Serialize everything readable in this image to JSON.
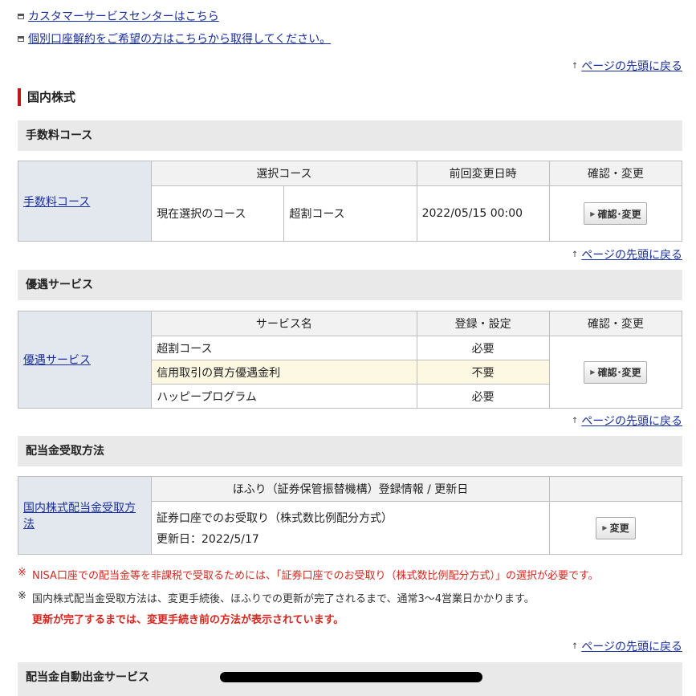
{
  "links": {
    "customer_center": "カスタマーサービスセンターはこちら",
    "account_cancel": "個別口座解約をご希望の方はこちらから取得してください。",
    "back_to_top": "ページの先頭に戻る"
  },
  "section": {
    "title": "国内株式"
  },
  "fee_course": {
    "subhead": "手数料コース",
    "left_link": "手数料コース",
    "headers": [
      "選択コース",
      "前回変更日時",
      "確認・変更"
    ],
    "row": {
      "label": "現在選択のコース",
      "value": "超割コース",
      "date": "2022/05/15 00:00"
    },
    "button": "確認･変更"
  },
  "service": {
    "subhead": "優遇サービス",
    "left_link": "優遇サービス",
    "headers": [
      "サービス名",
      "登録・設定",
      "確認・変更"
    ],
    "rows": [
      {
        "name": "超割コース",
        "status": "必要"
      },
      {
        "name": "信用取引の買方優遇金利",
        "status": "不要"
      },
      {
        "name": "ハッピープログラム",
        "status": "必要"
      }
    ],
    "button": "確認･変更"
  },
  "dividend": {
    "subhead": "配当金受取方法",
    "left_link": "国内株式配当金受取方法",
    "header": "ほふり（証券保管振替機構）登録情報 / 更新日",
    "method": "証券口座でのお受取り（株式数比例配分方式）",
    "updated": "更新日：2022/5/17",
    "button": "変更"
  },
  "notes": {
    "mark": "※",
    "nisa": "NISA口座での配当金等を非課税で受取るためには、「証券口座でのお受取り（株式数比例配分方式）」の選択が必要です。",
    "update_time": "国内株式配当金受取方法は、変更手続後、ほふりでの更新が完了されるまで、通常3〜4営業日かかります。",
    "warning": "更新が完了するまでは、変更手続き前の方法が表示されています。"
  },
  "auto_withdraw": {
    "subhead": "配当金自動出金サービス"
  },
  "colors": {
    "accent_red": "#c0171b",
    "link_blue": "#1a2f9e",
    "note_red": "#d6271f"
  }
}
